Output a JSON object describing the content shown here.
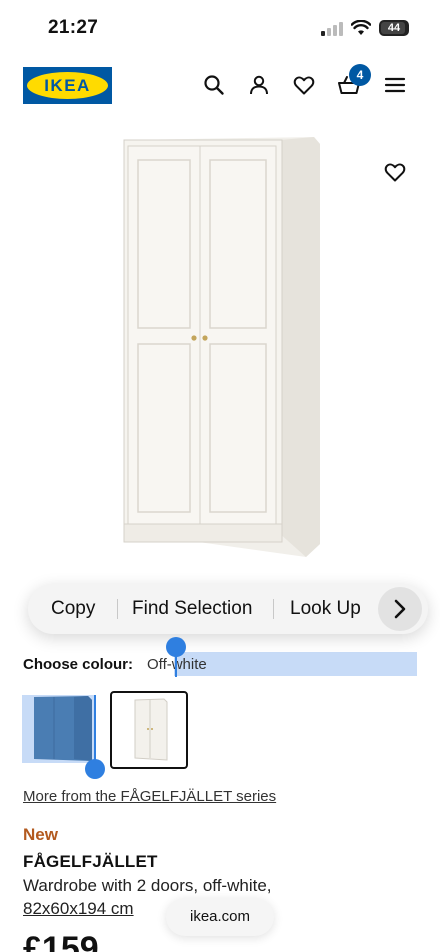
{
  "status_bar": {
    "time": "21:27",
    "battery": "44"
  },
  "header": {
    "logo_text": "IKEA",
    "icons": [
      "search-icon",
      "profile-icon",
      "heart-icon",
      "basket-icon",
      "menu-icon"
    ],
    "cart_count": "4"
  },
  "colors": {
    "ikea_blue": "#0058a3",
    "ikea_yellow": "#ffdb00",
    "new_badge": "#b35a1f",
    "selection": "#2f7fe0"
  },
  "context_menu": {
    "items": [
      "Copy",
      "Find Selection",
      "Look Up"
    ],
    "next_icon": "chevron-right-icon"
  },
  "colour": {
    "label": "Choose colour:",
    "value": "Off-white"
  },
  "swatches": [
    {
      "name": "blue",
      "selected": false
    },
    {
      "name": "off-white",
      "selected": true
    }
  ],
  "product": {
    "series_link": "More from the FÅGELFJÄLLET series",
    "badge": "New",
    "name": "FÅGELFJÄLLET",
    "description": "Wardrobe with 2 doors, off-white,",
    "size": "82x60x194 cm",
    "price": "£159"
  },
  "browser": {
    "url": "ikea.com"
  }
}
